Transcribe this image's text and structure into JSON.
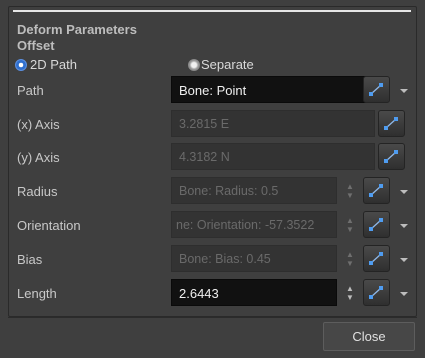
{
  "header": {
    "section_title": "Deform Parameters",
    "subsection_title": "Offset"
  },
  "mode": {
    "option_2d_path": "2D Path",
    "option_separate": "Separate",
    "selected": "2D Path"
  },
  "rows": {
    "path": {
      "label": "Path",
      "value": "Bone: Point"
    },
    "x_axis": {
      "label": "(x) Axis",
      "value": "3.2815 E"
    },
    "y_axis": {
      "label": "(y) Axis",
      "value": "4.3182 N"
    },
    "radius": {
      "label": "Radius",
      "value": "Bone: Radius: 0.5"
    },
    "orientation": {
      "label": "Orientation",
      "value": "ne: Orientation: -57.3522"
    },
    "bias": {
      "label": "Bias",
      "value": "Bone: Bias: 0.45"
    },
    "length": {
      "label": "Length",
      "value": "2.6443"
    }
  },
  "footer": {
    "close_label": "Close"
  },
  "icons": {
    "function_button": "function-curve-icon",
    "dropdown": "chevron-down-icon",
    "spinner": "spin-arrows-icon"
  },
  "colors": {
    "background": "#3f3f3f",
    "active_field": "#111111",
    "disabled_field": "#333333",
    "accent_blue": "#2f6fcf"
  }
}
